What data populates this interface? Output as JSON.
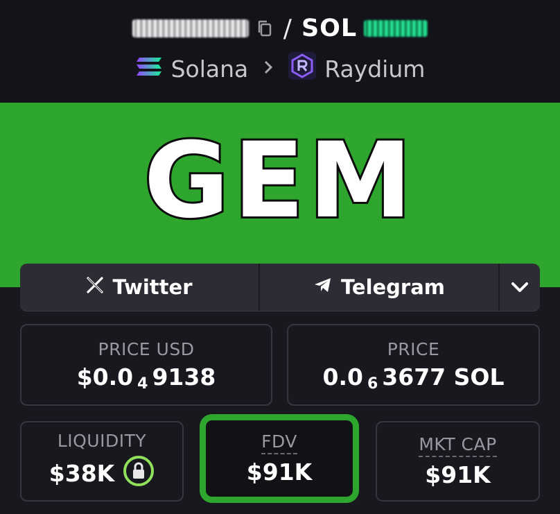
{
  "header": {
    "quote_symbol": "SOL",
    "separator": "/",
    "chain": "Solana",
    "dex": "Raydium"
  },
  "banner": {
    "text": "GEM",
    "background": "#2ea62d"
  },
  "links": {
    "twitter_label": "Twitter",
    "telegram_label": "Telegram"
  },
  "stats": {
    "price_usd": {
      "label": "PRICE USD",
      "prefix": "$0.0",
      "zeros": "4",
      "digits": "9138"
    },
    "price": {
      "label": "PRICE",
      "prefix": "0.0",
      "zeros": "6",
      "digits": "3677 SOL"
    },
    "liquidity": {
      "label": "LIQUIDITY",
      "value": "$38K"
    },
    "fdv": {
      "label": "FDV",
      "value": "$91K"
    },
    "mkt_cap": {
      "label": "MKT CAP",
      "value": "$91K"
    }
  },
  "icons": {
    "copy": "copy-icon",
    "twitter": "x-logo-icon",
    "telegram": "telegram-icon",
    "more": "chevron-down-icon",
    "lock": "lock-icon",
    "solana": "solana-logo-icon",
    "raydium": "raydium-logo-icon"
  },
  "colors": {
    "accent_green": "#2ea62d",
    "background": "#18181f",
    "header": "#131319"
  }
}
